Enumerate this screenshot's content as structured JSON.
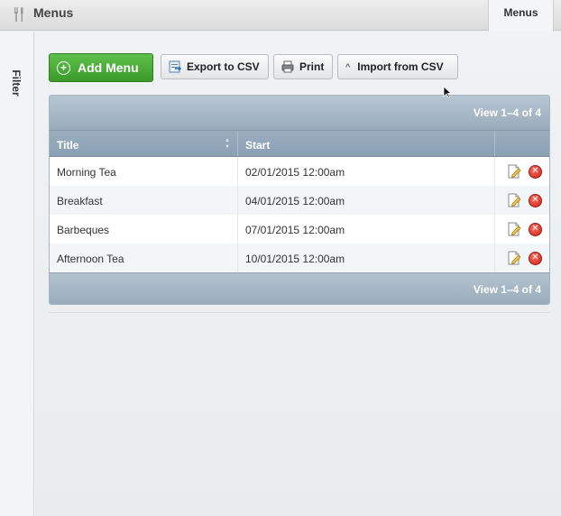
{
  "header": {
    "title": "Menus",
    "tab_label": "Menus"
  },
  "sidebar": {
    "filter_label": "Filter"
  },
  "toolbar": {
    "add_label": "Add Menu",
    "export_label": "Export to CSV",
    "print_label": "Print",
    "import_label": "Import from CSV"
  },
  "grid": {
    "view_top": "View 1–4 of 4",
    "view_bottom": "View 1–4 of 4",
    "columns": [
      "Title",
      "Start"
    ],
    "rows": [
      {
        "title": "Morning Tea",
        "start": "02/01/2015 12:00am"
      },
      {
        "title": "Breakfast",
        "start": "04/01/2015 12:00am"
      },
      {
        "title": "Barbeques",
        "start": "07/01/2015 12:00am"
      },
      {
        "title": "Afternoon Tea",
        "start": "10/01/2015 12:00am"
      }
    ]
  },
  "colors": {
    "accent_green": "#3a9a2a",
    "grid_header": "#9aaebf",
    "delete_red": "#c8241a"
  }
}
